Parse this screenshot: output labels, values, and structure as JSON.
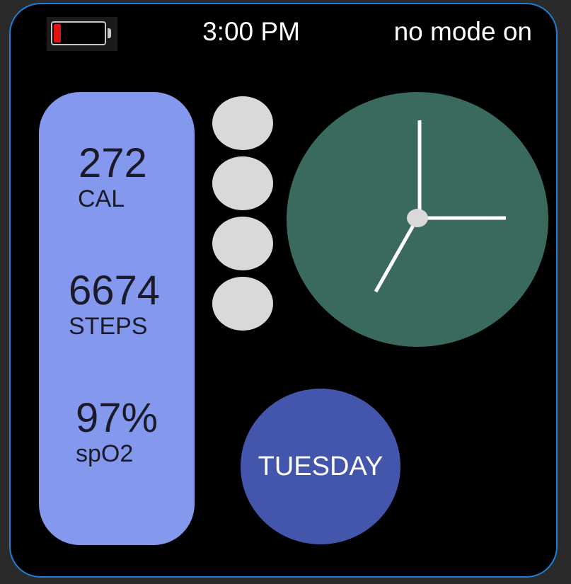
{
  "status_bar": {
    "battery": {
      "level": 0.1,
      "color": "#e11414",
      "icon": "battery-low-icon"
    },
    "time": "3:00 PM",
    "mode": "no mode on"
  },
  "stats": [
    {
      "value": "272",
      "unit": "CAL"
    },
    {
      "value": "6674",
      "unit": "STEPS"
    },
    {
      "value": "97%",
      "unit": "spO2"
    }
  ],
  "page_dots": {
    "count": 4
  },
  "clock": {
    "hour": 3,
    "minute": 0,
    "face_color": "#3a6a5d",
    "hand_color": "#ffffff"
  },
  "day": {
    "label": "TUESDAY",
    "color": "#4356ab"
  },
  "theme": {
    "frame_accent": "#1e7fd6",
    "stats_panel": "#8499ee"
  }
}
